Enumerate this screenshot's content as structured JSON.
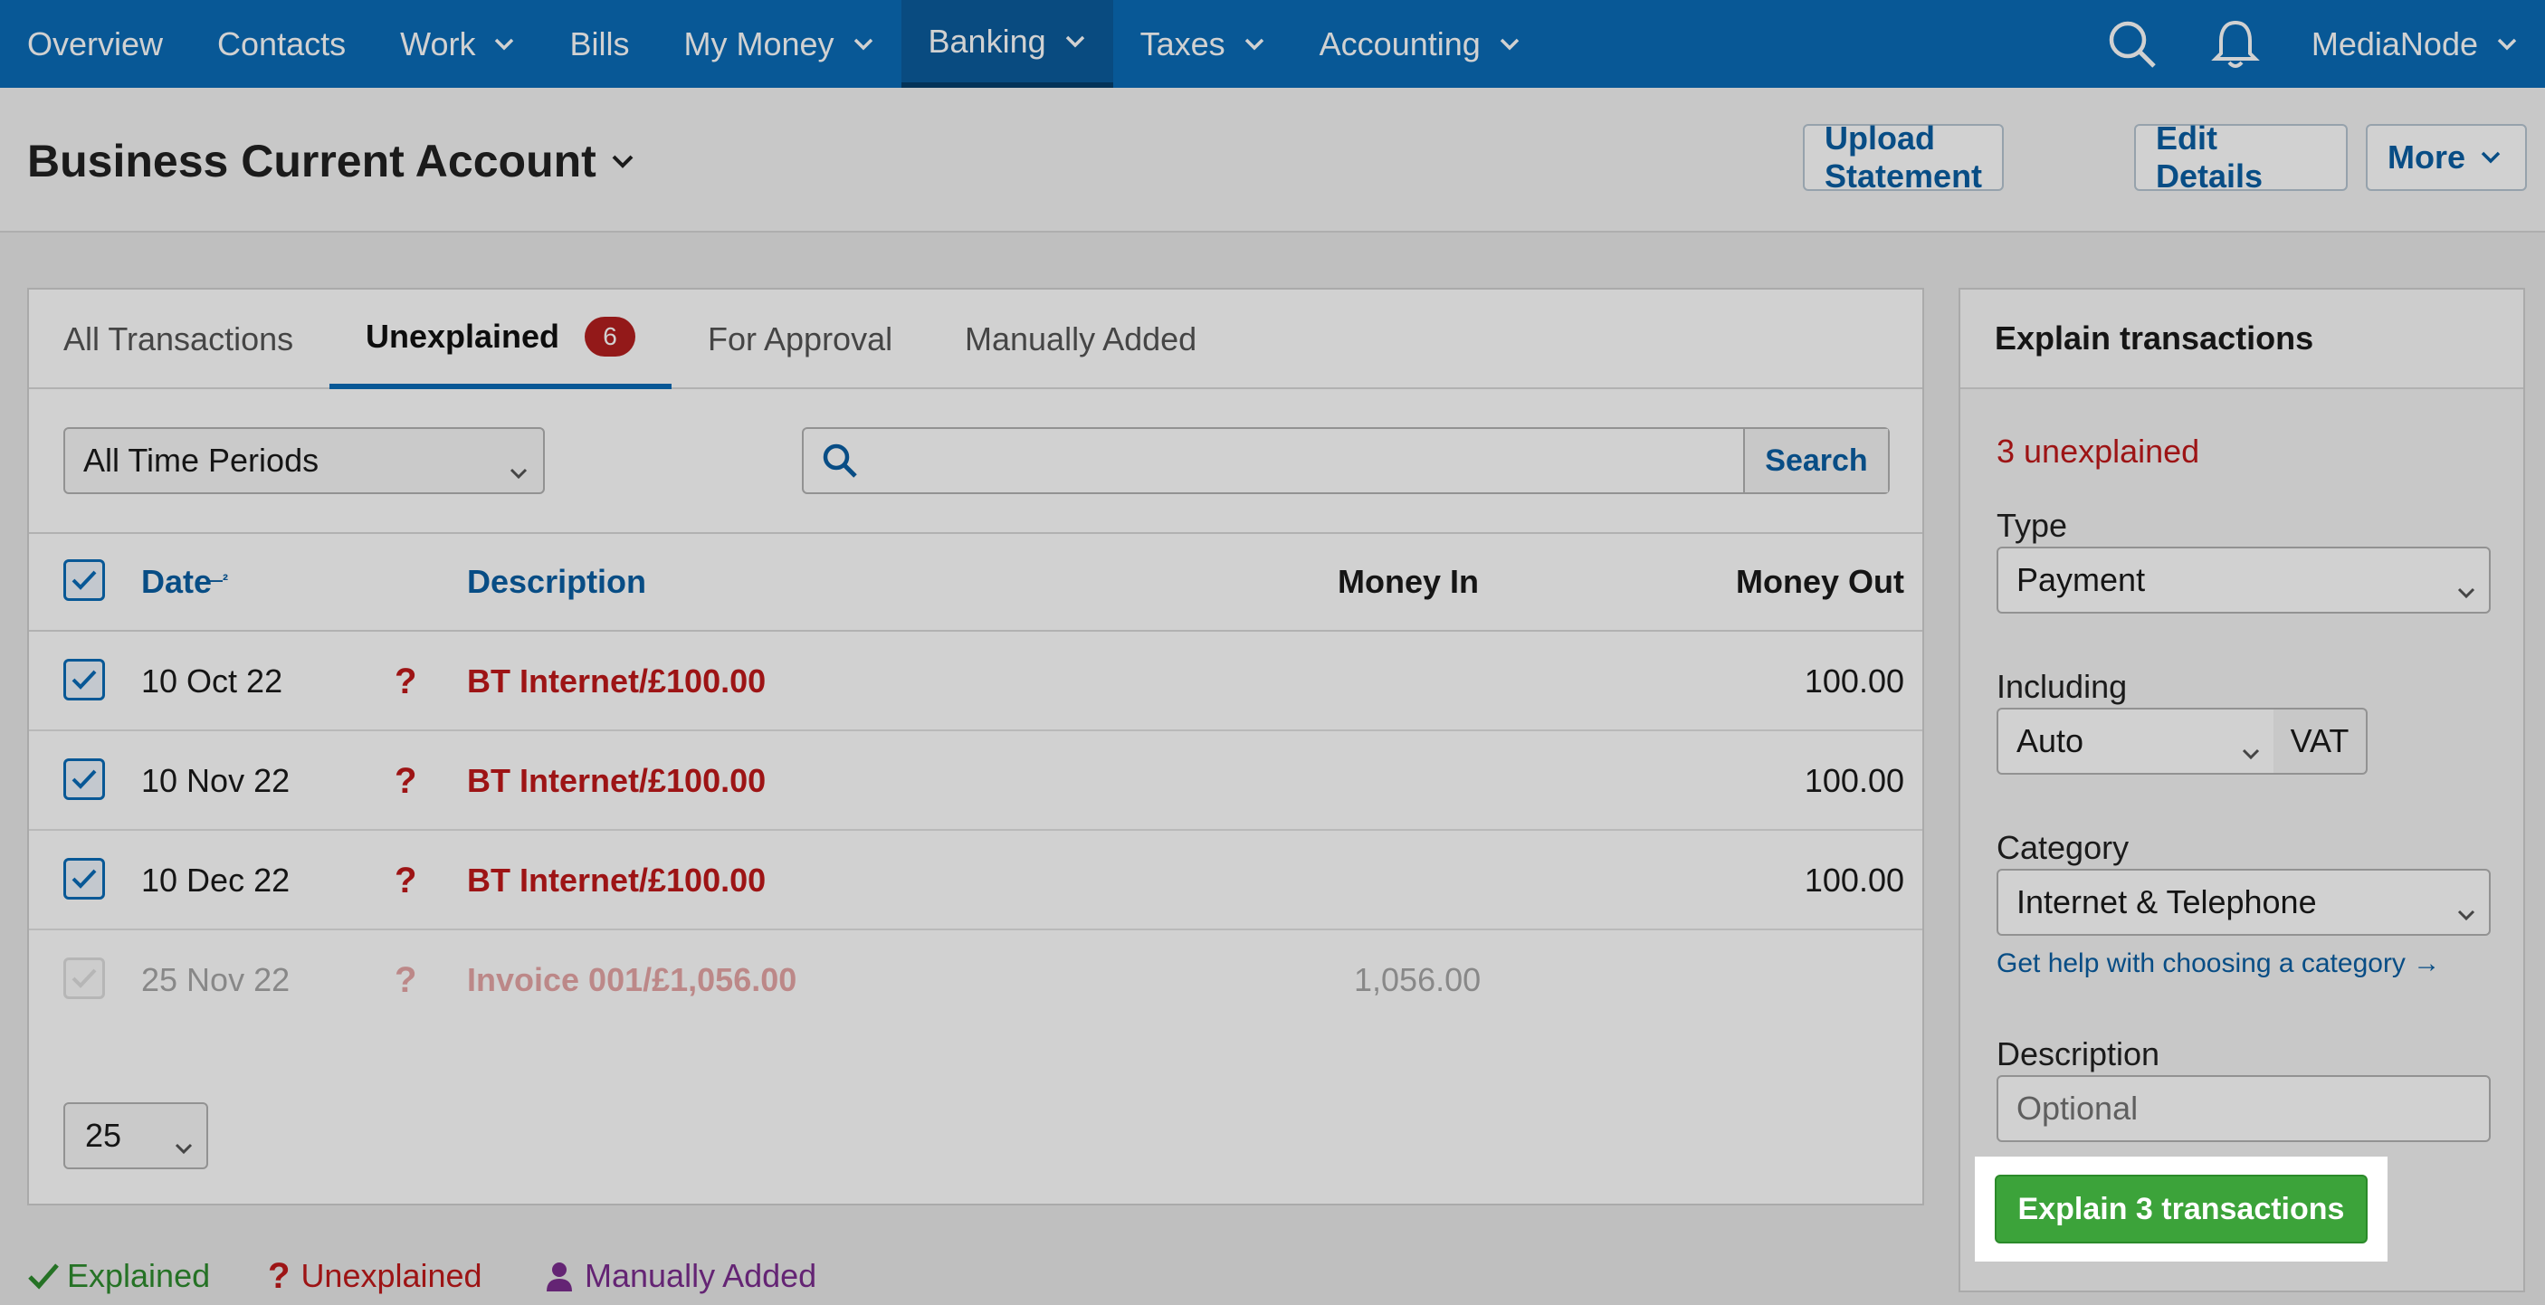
{
  "nav": {
    "items": [
      {
        "label": "Overview",
        "dropdown": false
      },
      {
        "label": "Contacts",
        "dropdown": false
      },
      {
        "label": "Work",
        "dropdown": true
      },
      {
        "label": "Bills",
        "dropdown": false
      },
      {
        "label": "My Money",
        "dropdown": true
      },
      {
        "label": "Banking",
        "dropdown": true,
        "active": true
      },
      {
        "label": "Taxes",
        "dropdown": true
      },
      {
        "label": "Accounting",
        "dropdown": true
      }
    ],
    "user": "MediaNode",
    "icons": [
      "search-icon",
      "bell-icon"
    ]
  },
  "header": {
    "title": "Business Current Account",
    "upload_label": "Upload Statement",
    "edit_label": "Edit Details",
    "more_label": "More"
  },
  "tabs": {
    "all": "All Transactions",
    "unexplained": "Unexplained",
    "unexplained_count": "6",
    "approval": "For Approval",
    "manual": "Manually Added"
  },
  "filters": {
    "period": "All Time Periods",
    "search_placeholder": "",
    "search_button": "Search"
  },
  "table": {
    "headers": {
      "date": "Date",
      "description": "Description",
      "money_in": "Money In",
      "money_out": "Money Out"
    },
    "rows": [
      {
        "date": "10 Oct 22",
        "status": "?",
        "description": "BT Internet/£100.00",
        "money_in": "",
        "money_out": "100.00",
        "checked": true
      },
      {
        "date": "10 Nov 22",
        "status": "?",
        "description": "BT Internet/£100.00",
        "money_in": "",
        "money_out": "100.00",
        "checked": true
      },
      {
        "date": "10 Dec 22",
        "status": "?",
        "description": "BT Internet/£100.00",
        "money_in": "",
        "money_out": "100.00",
        "checked": true
      },
      {
        "date": "25 Nov 22",
        "status": "?",
        "description": "Invoice 001/£1,056.00",
        "money_in": "1,056.00",
        "money_out": "",
        "checked": false
      }
    ],
    "per_page": "25"
  },
  "legend": {
    "explained": "Explained",
    "unexplained": "Unexplained",
    "manual": "Manually Added"
  },
  "explain": {
    "title": "Explain transactions",
    "count": "3 unexplained",
    "type_label": "Type",
    "type_value": "Payment",
    "including_label": "Including",
    "including_value": "Auto",
    "vat_label": "VAT",
    "category_label": "Category",
    "category_value": "Internet & Telephone",
    "help_link": "Get help with choosing a category →",
    "description_label": "Description",
    "description_placeholder": "Optional",
    "button": "Explain 3 transactions"
  },
  "colors": {
    "nav": "#0a6cb7",
    "link": "#0a5fa3",
    "error": "#c0191a",
    "success": "#3ca33a",
    "manual": "#7b2d8e"
  }
}
